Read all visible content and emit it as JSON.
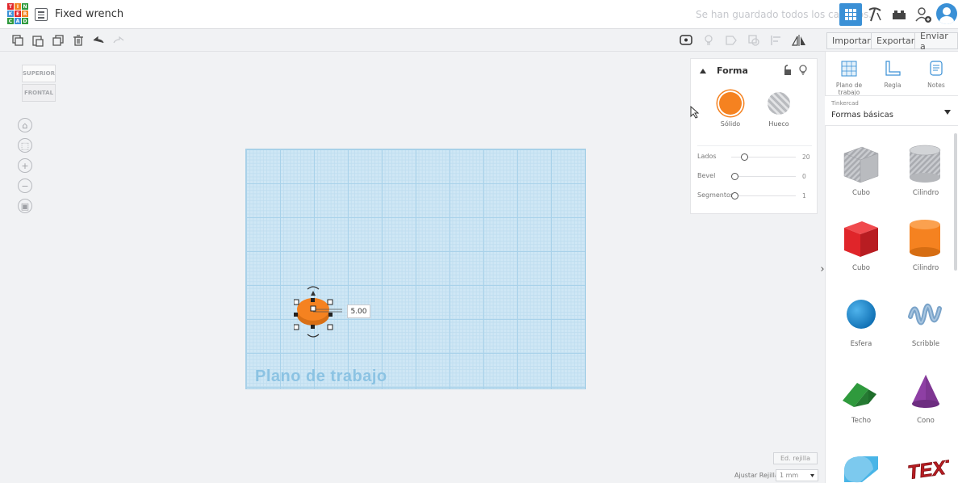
{
  "header": {
    "logo_letters": [
      "T",
      "I",
      "N",
      "K",
      "E",
      "R",
      "C",
      "A",
      "D"
    ],
    "doc_title": "Fixed wrench",
    "save_status": "Se han guardado todos los cambios."
  },
  "toolbar": {
    "import_label": "Importar",
    "export_label": "Exportar",
    "send_label": "Enviar a"
  },
  "viewcube": {
    "top_label": "SUPERIOR",
    "front_label": "FRONTAL"
  },
  "workplane": {
    "label": "Plano de trabajo",
    "dimension_value": "5.00"
  },
  "inspector": {
    "title": "Forma",
    "solid_label": "Sólido",
    "hole_label": "Hueco",
    "solid_color": "#f58220",
    "properties": [
      {
        "label": "Lados",
        "value": "20",
        "fraction": 0.15
      },
      {
        "label": "Bevel",
        "value": "0",
        "fraction": 0.0
      },
      {
        "label": "Segmentos",
        "value": "1",
        "fraction": 0.0
      }
    ]
  },
  "right_panel": {
    "top_items": [
      {
        "label": "Plano de trabajo",
        "icon": "workplane-icon"
      },
      {
        "label": "Regla",
        "icon": "ruler-icon"
      },
      {
        "label": "Notes",
        "icon": "notes-icon"
      }
    ],
    "library_caption": "Tinkercad",
    "library_value": "Formas básicas",
    "shapes": [
      {
        "label": "Cubo",
        "kind": "box-hole"
      },
      {
        "label": "Cilindro",
        "kind": "cylinder-hole"
      },
      {
        "label": "Cubo",
        "kind": "box"
      },
      {
        "label": "Cilindro",
        "kind": "cylinder"
      },
      {
        "label": "Esfera",
        "kind": "sphere"
      },
      {
        "label": "Scribble",
        "kind": "scribble"
      },
      {
        "label": "Techo",
        "kind": "roof"
      },
      {
        "label": "Cono",
        "kind": "cone"
      },
      {
        "label": "",
        "kind": "half-cylinder"
      },
      {
        "label": "",
        "kind": "text"
      }
    ],
    "text_shape_label": "TEXT"
  },
  "bottom": {
    "edit_grid_label": "Ed. rejilla",
    "snap_label": "Ajustar Rejilla",
    "snap_value": "1 mm"
  },
  "colors": {
    "accent_blue": "#3a90d6",
    "orange": "#f58220",
    "red": "#e0252a",
    "sphere_blue": "#1a8ad4",
    "green": "#2f9a3d",
    "purple": "#8e3fa4"
  }
}
